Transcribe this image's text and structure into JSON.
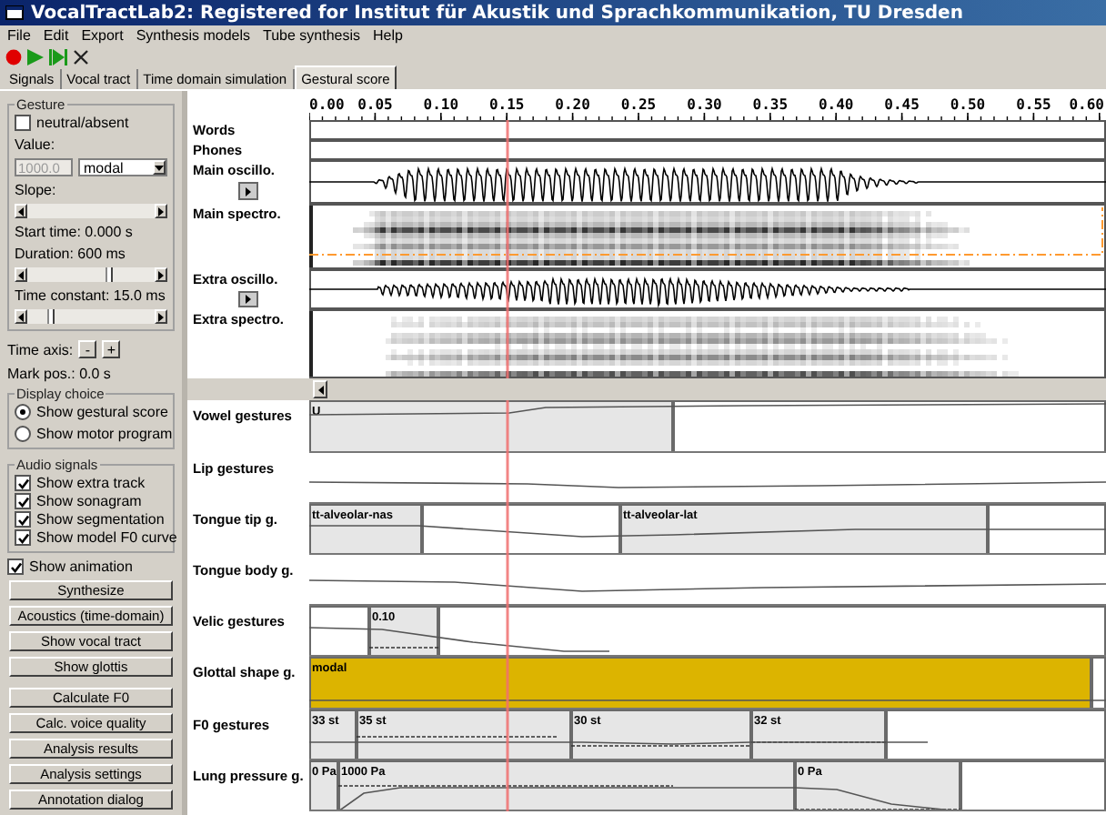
{
  "window": {
    "title": "VocalTractLab2: Registered for Institut für Akustik und Sprachkommunikation, TU Dresden"
  },
  "menu": [
    "File",
    "Edit",
    "Export",
    "Synthesis models",
    "Tube synthesis",
    "Help"
  ],
  "tabs": [
    {
      "label": "Signals",
      "selected": false
    },
    {
      "label": "Vocal tract",
      "selected": false
    },
    {
      "label": "Time domain simulation",
      "selected": false
    },
    {
      "label": "Gestural score",
      "selected": true
    }
  ],
  "gesture": {
    "title": "Gesture",
    "neutral": {
      "label": "neutral/absent",
      "checked": false
    },
    "value_label": "Value:",
    "value_field": {
      "value": "1000.0",
      "disabled": true
    },
    "type_select": {
      "value": "modal"
    },
    "slope_label": "Slope:",
    "slope_slider": {
      "disabled": true
    },
    "start_time": "Start time: 0.000 s",
    "duration": "Duration: 600 ms",
    "duration_slider": {
      "level": 0.64
    },
    "time_constant": "Time constant: 15.0 ms",
    "time_constant_slider": {
      "level": 0.18
    }
  },
  "time_axis": {
    "label": "Time axis:",
    "buttons": [
      "-",
      "+"
    ]
  },
  "mark_pos": "Mark pos.: 0.0 s",
  "display_choice": {
    "title": "Display choice",
    "options": [
      {
        "label": "Show gestural score",
        "selected": true
      },
      {
        "label": "Show motor program",
        "selected": false
      }
    ]
  },
  "audio_signals": {
    "title": "Audio signals",
    "options": [
      {
        "label": "Show extra track",
        "checked": true
      },
      {
        "label": "Show sonagram",
        "checked": true
      },
      {
        "label": "Show segmentation",
        "checked": true
      },
      {
        "label": "Show model F0 curve",
        "checked": true
      }
    ]
  },
  "show_animation": {
    "label": "Show animation",
    "checked": true
  },
  "button_groups": [
    [
      "Synthesize",
      "Acoustics (time-domain)",
      "Show vocal tract",
      "Show glottis"
    ],
    [
      "Calculate F0",
      "Calc. voice quality",
      "Analysis results",
      "Analysis settings",
      "Annotation dialog"
    ]
  ],
  "score": {
    "time_ticks": [
      "0.00",
      "0.05",
      "0.10",
      "0.15",
      "0.20",
      "0.25",
      "0.30",
      "0.35",
      "0.40",
      "0.45",
      "0.50",
      "0.55",
      "0.60"
    ],
    "signal_tracks": [
      {
        "label": "Words",
        "kind": "segmentation"
      },
      {
        "label": "Phones",
        "kind": "segmentation"
      },
      {
        "label": "Main oscillo.",
        "kind": "oscillogram"
      },
      {
        "label": "Main spectro.",
        "kind": "spectrogram"
      },
      {
        "label": "Extra oscillo.",
        "kind": "oscillogram"
      },
      {
        "label": "Extra spectro.",
        "kind": "spectrogram"
      }
    ],
    "tiers": [
      {
        "label": "Vowel gestures",
        "segments": [
          {
            "label": "U",
            "color": "#e6e6e6"
          },
          {
            "color": "#ffffff"
          }
        ]
      },
      {
        "label": "Lip gestures"
      },
      {
        "label": "Tongue tip g.",
        "segments": [
          {
            "label": "tt-alveolar-nas",
            "color": "#e6e6e6"
          },
          {
            "color": "#ffffff"
          },
          {
            "label": "tt-alveolar-lat",
            "color": "#e6e6e6"
          },
          {
            "color": "#ffffff"
          }
        ]
      },
      {
        "label": "Tongue body g."
      },
      {
        "label": "Velic gestures",
        "segments": [
          {
            "color": "#ffffff"
          },
          {
            "label": "0.10",
            "color": "#e6e6e6"
          },
          {
            "color": "#ffffff"
          }
        ]
      },
      {
        "label": "Glottal shape g.",
        "segments": [
          {
            "label": "modal",
            "color": "#dcb400"
          },
          {
            "color": "#ffffff"
          }
        ]
      },
      {
        "label": "F0 gestures",
        "segments": [
          {
            "label": "33 st",
            "color": "#e6e6e6"
          },
          {
            "label": "35 st",
            "color": "#e6e6e6"
          },
          {
            "label": "30 st",
            "color": "#e6e6e6"
          },
          {
            "label": "32 st",
            "color": "#e6e6e6"
          },
          {
            "color": "#ffffff"
          }
        ]
      },
      {
        "label": "Lung pressure g.",
        "segments": [
          {
            "label": "0 Pa",
            "color": "#e6e6e6"
          },
          {
            "label": "1000 Pa",
            "color": "#e6e6e6"
          },
          {
            "label": "0 Pa",
            "color": "#e6e6e6"
          },
          {
            "color": "#ffffff"
          }
        ]
      }
    ]
  }
}
